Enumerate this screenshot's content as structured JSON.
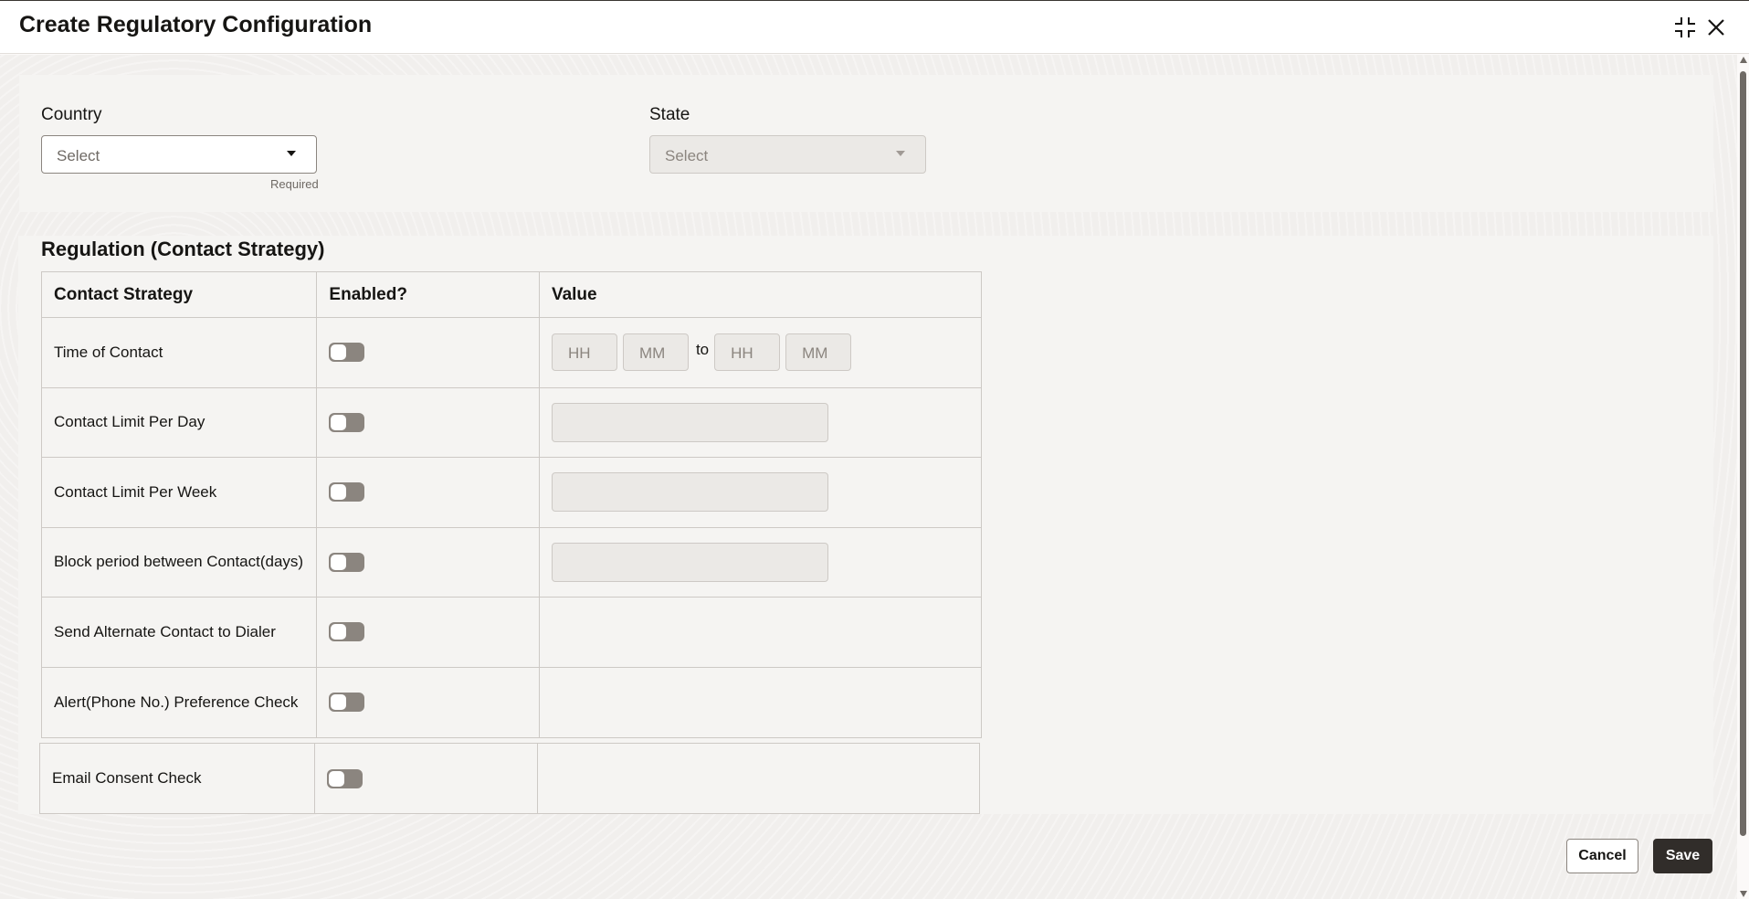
{
  "dialog": {
    "title": "Create Regulatory Configuration",
    "icons": [
      "collapse-icon",
      "close-icon"
    ]
  },
  "form": {
    "country": {
      "label": "Country",
      "placeholder": "Select",
      "helper": "Required"
    },
    "state": {
      "label": "State",
      "placeholder": "Select",
      "disabled": true
    }
  },
  "regulation": {
    "title": "Regulation (Contact Strategy)",
    "columns": [
      "Contact Strategy",
      "Enabled?",
      "Value"
    ],
    "time_placeholders": {
      "hh": "HH",
      "mm": "MM",
      "to": "to"
    },
    "rows": [
      {
        "label": "Time of Contact",
        "enabled": false,
        "value_type": "time-range"
      },
      {
        "label": "Contact Limit Per Day",
        "enabled": false,
        "value_type": "number"
      },
      {
        "label": "Contact Limit Per Week",
        "enabled": false,
        "value_type": "number"
      },
      {
        "label": "Block period between Contact(days)",
        "enabled": false,
        "value_type": "number"
      },
      {
        "label": "Send Alternate Contact to Dialer",
        "enabled": false,
        "value_type": "none"
      },
      {
        "label": "Alert(Phone No.) Preference Check",
        "enabled": false,
        "value_type": "none"
      },
      {
        "label": "Email Consent Check",
        "enabled": false,
        "value_type": "none"
      }
    ]
  },
  "footer": {
    "cancel_label": "Cancel",
    "save_label": "Save"
  },
  "colors": {
    "primary_button": "#312d2a",
    "toggle_off": "#8b857f",
    "background": "#f1efed"
  }
}
